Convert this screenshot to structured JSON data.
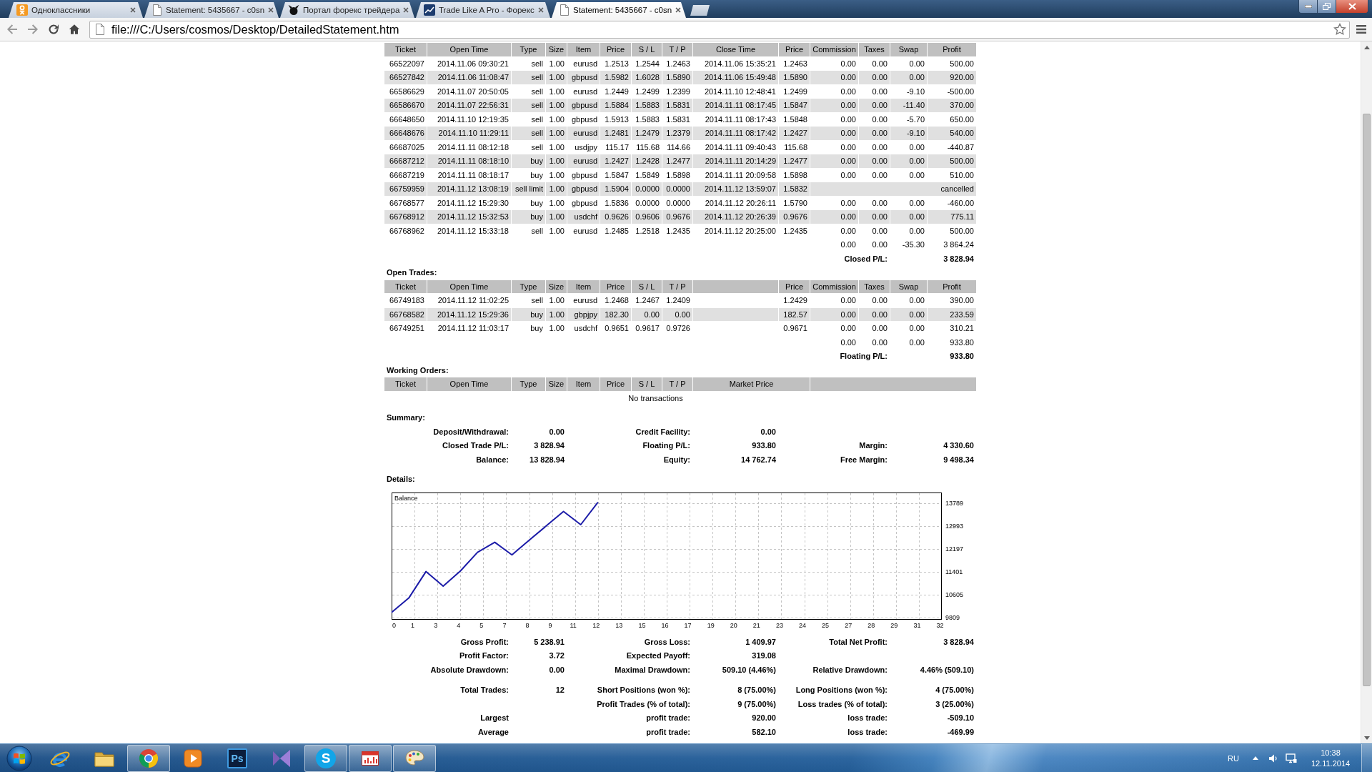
{
  "browser": {
    "tabs": [
      {
        "title": "Одноклассники",
        "selected": false
      },
      {
        "title": "Statement: 5435667 - c0sn",
        "selected": false
      },
      {
        "title": "Портал форекс трейдера",
        "selected": false
      },
      {
        "title": "Trade Like A Pro - Форекс",
        "selected": false
      },
      {
        "title": "Statement: 5435667 - c0sn",
        "selected": true
      }
    ],
    "address": "file:///C:/Users/cosmos/Desktop/DetailedStatement.htm"
  },
  "statement": {
    "closed_transactions": {
      "columns": [
        "Ticket",
        "Open Time",
        "Type",
        "Size",
        "Item",
        "Price",
        "S / L",
        "T / P",
        "Close Time",
        "Price",
        "Commission",
        "Taxes",
        "Swap",
        "Profit"
      ],
      "rows": [
        {
          "cells": [
            "66522097",
            "2014.11.06 09:30:21",
            "sell",
            "1.00",
            "eurusd",
            "1.2513",
            "1.2544",
            "1.2463",
            "2014.11.06 15:35:21",
            "1.2463",
            "0.00",
            "0.00",
            "0.00",
            "500.00"
          ]
        },
        {
          "cells": [
            "66527842",
            "2014.11.06 11:08:47",
            "sell",
            "1.00",
            "gbpusd",
            "1.5982",
            "1.6028",
            "1.5890",
            "2014.11.06 15:49:48",
            "1.5890",
            "0.00",
            "0.00",
            "0.00",
            "920.00"
          ]
        },
        {
          "cells": [
            "66586629",
            "2014.11.07 20:50:05",
            "sell",
            "1.00",
            "eurusd",
            "1.2449",
            "1.2499",
            "1.2399",
            "2014.11.10 12:48:41",
            "1.2499",
            "0.00",
            "0.00",
            "-9.10",
            "-500.00"
          ]
        },
        {
          "cells": [
            "66586670",
            "2014.11.07 22:56:31",
            "sell",
            "1.00",
            "gbpusd",
            "1.5884",
            "1.5883",
            "1.5831",
            "2014.11.11 08:17:45",
            "1.5847",
            "0.00",
            "0.00",
            "-11.40",
            "370.00"
          ]
        },
        {
          "cells": [
            "66648650",
            "2014.11.10 12:19:35",
            "sell",
            "1.00",
            "gbpusd",
            "1.5913",
            "1.5883",
            "1.5831",
            "2014.11.11 08:17:43",
            "1.5848",
            "0.00",
            "0.00",
            "-5.70",
            "650.00"
          ]
        },
        {
          "cells": [
            "66648676",
            "2014.11.10 11:29:11",
            "sell",
            "1.00",
            "eurusd",
            "1.2481",
            "1.2479",
            "1.2379",
            "2014.11.11 08:17:42",
            "1.2427",
            "0.00",
            "0.00",
            "-9.10",
            "540.00"
          ]
        },
        {
          "cells": [
            "66687025",
            "2014.11.11 08:12:18",
            "sell",
            "1.00",
            "usdjpy",
            "115.17",
            "115.68",
            "114.66",
            "2014.11.11 09:40:43",
            "115.68",
            "0.00",
            "0.00",
            "0.00",
            "-440.87"
          ]
        },
        {
          "cells": [
            "66687212",
            "2014.11.11 08:18:10",
            "buy",
            "1.00",
            "eurusd",
            "1.2427",
            "1.2428",
            "1.2477",
            "2014.11.11 20:14:29",
            "1.2477",
            "0.00",
            "0.00",
            "0.00",
            "500.00"
          ]
        },
        {
          "cells": [
            "66687219",
            "2014.11.11 08:18:17",
            "buy",
            "1.00",
            "gbpusd",
            "1.5847",
            "1.5849",
            "1.5898",
            "2014.11.11 20:09:58",
            "1.5898",
            "0.00",
            "0.00",
            "0.00",
            "510.00"
          ]
        },
        {
          "cells": [
            "66759959",
            "2014.11.12 13:08:19",
            "sell limit",
            "1.00",
            "gbpusd",
            "1.5904",
            "0.0000",
            "0.0000",
            "2014.11.12 13:59:07",
            "1.5832",
            {
              "text": "cancelled",
              "colspan": 4
            }
          ]
        },
        {
          "cells": [
            "66768577",
            "2014.11.12 15:29:30",
            "buy",
            "1.00",
            "gbpusd",
            "1.5836",
            "0.0000",
            "0.0000",
            "2014.11.12 20:26:11",
            "1.5790",
            "0.00",
            "0.00",
            "0.00",
            "-460.00"
          ]
        },
        {
          "cells": [
            "66768912",
            "2014.11.12 15:32:53",
            "buy",
            "1.00",
            "usdchf",
            "0.9626",
            "0.9606",
            "0.9676",
            "2014.11.12 20:26:39",
            "0.9676",
            "0.00",
            "0.00",
            "0.00",
            "775.11"
          ]
        },
        {
          "cells": [
            "66768962",
            "2014.11.12 15:33:18",
            "sell",
            "1.00",
            "eurusd",
            "1.2485",
            "1.2518",
            "1.2435",
            "2014.11.12 20:25:00",
            "1.2435",
            "0.00",
            "0.00",
            "0.00",
            "500.00"
          ]
        }
      ],
      "totals": [
        "0.00",
        "0.00",
        "-35.30",
        "3 864.24"
      ],
      "closed_pl": {
        "label": "Closed P/L:",
        "value": "3 828.94"
      }
    },
    "open_trades": {
      "title": "Open Trades:",
      "columns": [
        "Ticket",
        "Open Time",
        "Type",
        "Size",
        "Item",
        "Price",
        "S / L",
        "T / P",
        "Price",
        "Commission",
        "Taxes",
        "Swap",
        "Profit"
      ],
      "rows": [
        {
          "cells": [
            "66749183",
            "2014.11.12 11:02:25",
            "sell",
            "1.00",
            "eurusd",
            "1.2468",
            "1.2467",
            "1.2409",
            "1.2429",
            "0.00",
            "0.00",
            "0.00",
            "390.00"
          ]
        },
        {
          "cells": [
            "66768582",
            "2014.11.12 15:29:36",
            "buy",
            "1.00",
            "gbpjpy",
            "182.30",
            "0.00",
            "0.00",
            "182.57",
            "0.00",
            "0.00",
            "0.00",
            "233.59"
          ]
        },
        {
          "cells": [
            "66749251",
            "2014.11.12 11:03:17",
            "buy",
            "1.00",
            "usdchf",
            "0.9651",
            "0.9617",
            "0.9726",
            "0.9671",
            "0.00",
            "0.00",
            "0.00",
            "310.21"
          ]
        }
      ],
      "totals": [
        "0.00",
        "0.00",
        "0.00",
        "933.80"
      ],
      "floating_pl": {
        "label": "Floating P/L:",
        "value": "933.80"
      }
    },
    "working_orders": {
      "title": "Working Orders:",
      "columns": [
        "Ticket",
        "Open Time",
        "Type",
        "Size",
        "Item",
        "Price",
        "S / L",
        "T / P",
        "Market Price"
      ],
      "empty_text": "No transactions"
    },
    "summary": {
      "title": "Summary:",
      "rows": [
        {
          "column_1": {
            "label": "Deposit/Withdrawal:",
            "value": "0.00"
          },
          "column_2": {
            "label": "Credit Facility:",
            "value": "0.00"
          }
        },
        {
          "column_1": {
            "label": "Closed Trade P/L:",
            "value": "3 828.94"
          },
          "column_2": {
            "label": "Floating P/L:",
            "value": "933.80"
          },
          "column_3": {
            "label": "Margin:",
            "value": "4 330.60"
          }
        },
        {
          "column_1": {
            "label": "Balance:",
            "value": "13 828.94"
          },
          "column_2": {
            "label": "Equity:",
            "value": "14 762.74"
          },
          "column_3": {
            "label": "Free Margin:",
            "value": "9 498.34"
          }
        }
      ]
    },
    "details": {
      "title": "Details:",
      "chart_data": {
        "type": "line",
        "x": [
          0,
          1,
          2,
          3,
          4,
          5,
          6,
          7,
          8,
          9,
          10,
          11,
          12
        ],
        "series": [
          {
            "name": "Balance",
            "color": "#1c1ca8",
            "values": [
              10000,
              10500,
              11420,
              10910,
              11440,
              12090,
              12440,
              12000,
              12510,
              13010,
              13510,
              13050,
              13830
            ]
          }
        ],
        "xlim": [
          0,
          32
        ],
        "ylim": [
          9743,
          14170
        ],
        "xticks": [
          {
            "value": 0,
            "label": "0"
          },
          {
            "value": 1.333,
            "label": "1"
          },
          {
            "value": 2.667,
            "label": "3"
          },
          {
            "value": 4,
            "label": "4"
          },
          {
            "value": 5.333,
            "label": "5"
          },
          {
            "value": 6.667,
            "label": "7"
          },
          {
            "value": 8,
            "label": "8"
          },
          {
            "value": 9.333,
            "label": "9"
          },
          {
            "value": 10.667,
            "label": "11"
          },
          {
            "value": 12,
            "label": "12"
          },
          {
            "value": 13.333,
            "label": "13"
          },
          {
            "value": 14.667,
            "label": "15"
          },
          {
            "value": 16,
            "label": "16"
          },
          {
            "value": 17.333,
            "label": "17"
          },
          {
            "value": 18.667,
            "label": "19"
          },
          {
            "value": 20,
            "label": "20"
          },
          {
            "value": 21.333,
            "label": "21"
          },
          {
            "value": 22.667,
            "label": "23"
          },
          {
            "value": 24,
            "label": "24"
          },
          {
            "value": 25.333,
            "label": "25"
          },
          {
            "value": 26.667,
            "label": "27"
          },
          {
            "value": 28,
            "label": "28"
          },
          {
            "value": 29.333,
            "label": "29"
          },
          {
            "value": 30.667,
            "label": "31"
          },
          {
            "value": 32,
            "label": "32"
          }
        ],
        "yticks": [
          9809,
          10605,
          11401,
          12197,
          12993,
          13789
        ],
        "grid": true
      }
    },
    "statistics": [
      [
        {
          "column_1": {
            "label": "Gross Profit:",
            "value": "5 238.91"
          },
          "column_2": {
            "label": "Gross Loss:",
            "value": "1 409.97"
          },
          "column_3": {
            "label": "Total Net Profit:",
            "value": "3 828.94"
          }
        },
        {
          "column_1": {
            "label": "Profit Factor:",
            "value": "3.72"
          },
          "column_2": {
            "label": "Expected Payoff:",
            "value": "319.08"
          }
        },
        {
          "column_1": {
            "label": "Absolute Drawdown:",
            "value": "0.00"
          },
          "column_2": {
            "label": "Maximal Drawdown:",
            "value": "509.10 (4.46%)"
          },
          "column_3": {
            "label": "Relative Drawdown:",
            "value": "4.46% (509.10)"
          }
        }
      ],
      [
        {
          "column_1": {
            "label": "Total Trades:",
            "value": "12"
          },
          "column_2": {
            "label": "Short Positions (won %):",
            "value": "8 (75.00%)"
          },
          "column_3": {
            "label": "Long Positions (won %):",
            "value": "4 (75.00%)"
          }
        },
        {
          "column_2": {
            "label": "Profit Trades (% of total):",
            "value": "9 (75.00%)"
          },
          "column_3": {
            "label": "Loss trades (% of total):",
            "value": "3 (25.00%)"
          }
        },
        {
          "column_1": {
            "label": "Largest"
          },
          "column_2": {
            "label": "profit trade:",
            "value": "920.00"
          },
          "column_3": {
            "label": "loss trade:",
            "value": "-509.10"
          }
        },
        {
          "column_1": {
            "label": "Average"
          },
          "column_2": {
            "label": "profit trade:",
            "value": "582.10"
          },
          "column_3": {
            "label": "loss trade:",
            "value": "-469.99"
          }
        }
      ]
    ]
  },
  "taskbar": {
    "apps": [
      {
        "running": false
      },
      {
        "running": false
      },
      {
        "running": true
      },
      {
        "running": false
      },
      {
        "glyph": "Ps",
        "running": false
      },
      {
        "running": false
      },
      {
        "glyph": "S",
        "running": true
      },
      {
        "running": true
      },
      {
        "running": true
      }
    ],
    "language": "RU",
    "time": "10:38",
    "date": "12.11.2014"
  }
}
